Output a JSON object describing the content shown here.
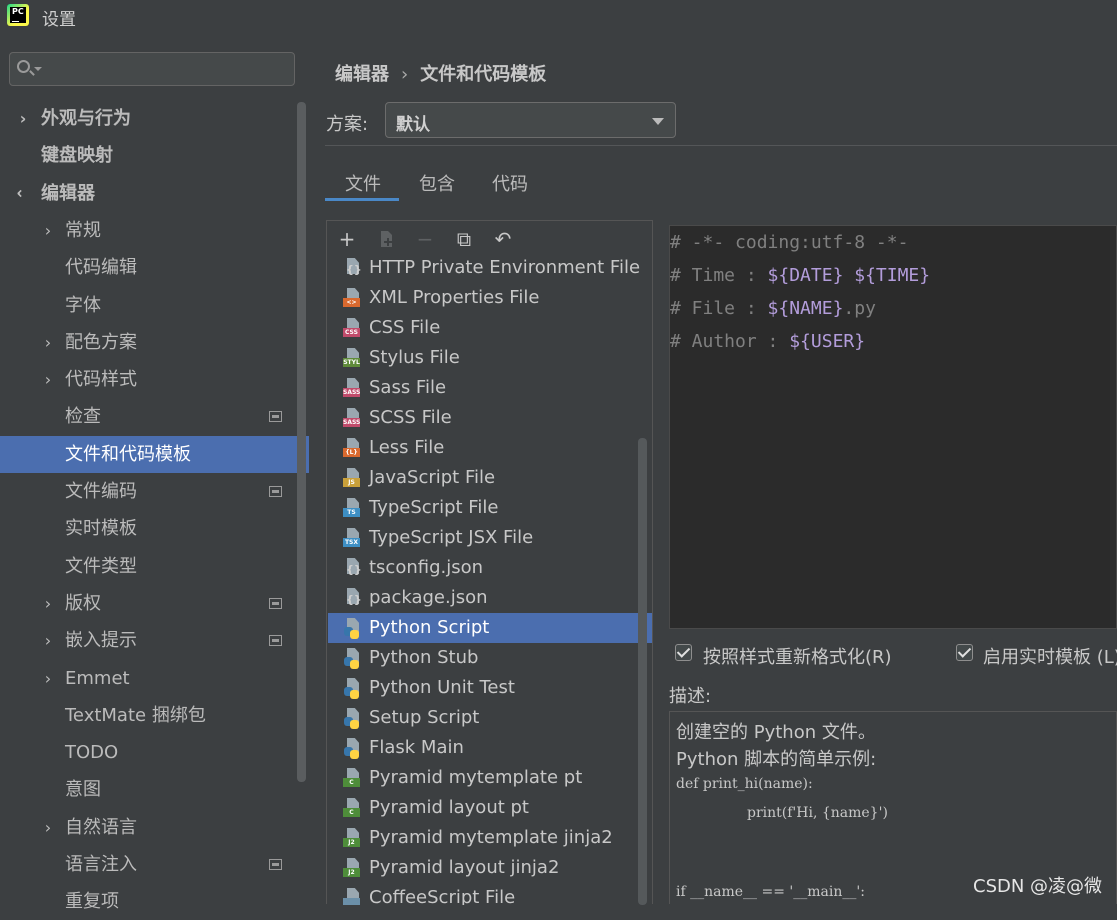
{
  "window": {
    "title": "设置",
    "app_icon_text": "PC"
  },
  "sidebar": {
    "search_placeholder": "",
    "items": [
      {
        "label": "外观与行为",
        "arrow": "›"
      },
      {
        "label": "键盘映射",
        "arrow": ""
      },
      {
        "label": "编辑器",
        "arrow": "⌄"
      },
      {
        "label": "常规",
        "arrow": "›"
      },
      {
        "label": "代码编辑",
        "arrow": ""
      },
      {
        "label": "字体",
        "arrow": ""
      },
      {
        "label": "配色方案",
        "arrow": "›"
      },
      {
        "label": "代码样式",
        "arrow": "›"
      },
      {
        "label": "检查",
        "arrow": ""
      },
      {
        "label": "文件和代码模板",
        "arrow": ""
      },
      {
        "label": "文件编码",
        "arrow": ""
      },
      {
        "label": "实时模板",
        "arrow": ""
      },
      {
        "label": "文件类型",
        "arrow": ""
      },
      {
        "label": "版权",
        "arrow": "›"
      },
      {
        "label": "嵌入提示",
        "arrow": "›"
      },
      {
        "label": "Emmet",
        "arrow": "›"
      },
      {
        "label": "TextMate 捆绑包",
        "arrow": ""
      },
      {
        "label": "TODO",
        "arrow": ""
      },
      {
        "label": "意图",
        "arrow": ""
      },
      {
        "label": "自然语言",
        "arrow": "›"
      },
      {
        "label": "语言注入",
        "arrow": ""
      },
      {
        "label": "重复项",
        "arrow": ""
      }
    ],
    "selected": "文件和代码模板"
  },
  "breadcrumb": {
    "parent": "编辑器",
    "separator": "›",
    "current": "文件和代码模板"
  },
  "scheme": {
    "label": "方案:",
    "value": "默认"
  },
  "tabs": [
    {
      "label": "文件"
    },
    {
      "label": "包含"
    },
    {
      "label": "代码"
    }
  ],
  "active_tab": "文件",
  "toolbar": {
    "add": "+",
    "remove": "−",
    "copy": "⧉",
    "reset": "↶"
  },
  "templates": [
    {
      "label": "HTTP Private Environment File",
      "icon": "json-file-icon",
      "badge": "",
      "color": ""
    },
    {
      "label": "XML Properties File",
      "icon": "xml-file-icon",
      "badge": "<>",
      "color": "#d9692f"
    },
    {
      "label": "CSS File",
      "icon": "css-file-icon",
      "badge": "CSS",
      "color": "#c14b6b"
    },
    {
      "label": "Stylus File",
      "icon": "stylus-file-icon",
      "badge": "STYL",
      "color": "#5f8b3a"
    },
    {
      "label": "Sass File",
      "icon": "sass-file-icon",
      "badge": "SASS",
      "color": "#c14b6b"
    },
    {
      "label": "SCSS File",
      "icon": "scss-file-icon",
      "badge": "SASS",
      "color": "#c14b6b"
    },
    {
      "label": "Less File",
      "icon": "less-file-icon",
      "badge": "{L}",
      "color": "#d9692f"
    },
    {
      "label": "JavaScript File",
      "icon": "javascript-file-icon",
      "badge": "JS",
      "color": "#c9a03a"
    },
    {
      "label": "TypeScript File",
      "icon": "typescript-file-icon",
      "badge": "TS",
      "color": "#3e8fc4"
    },
    {
      "label": "TypeScript JSX File",
      "icon": "tsx-file-icon",
      "badge": "TSX",
      "color": "#3e8fc4"
    },
    {
      "label": "tsconfig.json",
      "icon": "json-file-icon",
      "badge": "",
      "color": ""
    },
    {
      "label": "package.json",
      "icon": "json-file-icon",
      "badge": "",
      "color": ""
    },
    {
      "label": "Python Script",
      "icon": "python-file-icon",
      "badge": "",
      "color": ""
    },
    {
      "label": "Python Stub",
      "icon": "python-file-icon",
      "badge": "",
      "color": ""
    },
    {
      "label": "Python Unit Test",
      "icon": "python-file-icon",
      "badge": "",
      "color": ""
    },
    {
      "label": "Setup Script",
      "icon": "python-file-icon",
      "badge": "",
      "color": ""
    },
    {
      "label": "Flask Main",
      "icon": "python-file-icon",
      "badge": "",
      "color": ""
    },
    {
      "label": "Pyramid mytemplate pt",
      "icon": "chameleon-file-icon",
      "badge": "C",
      "color": "#4e8d3a"
    },
    {
      "label": "Pyramid layout pt",
      "icon": "chameleon-file-icon",
      "badge": "C",
      "color": "#4e8d3a"
    },
    {
      "label": "Pyramid mytemplate jinja2",
      "icon": "jinja2-file-icon",
      "badge": "J2",
      "color": "#4e8d3a"
    },
    {
      "label": "Pyramid layout jinja2",
      "icon": "jinja2-file-icon",
      "badge": "J2",
      "color": "#4e8d3a"
    },
    {
      "label": "CoffeeScript File",
      "icon": "coffeescript-file-icon",
      "badge": "",
      "color": "#6b8fa8"
    }
  ],
  "selected_template": "Python Script",
  "editor": {
    "lines": [
      {
        "prefix": "# -*- coding:utf-8 -*-",
        "var1": "",
        "mid": "",
        "var2": "",
        "suffix": ""
      },
      {
        "prefix": "# Time : ",
        "var1": "${DATE}",
        "mid": " ",
        "var2": "${TIME}",
        "suffix": ""
      },
      {
        "prefix": "# File : ",
        "var1": "${NAME}",
        "mid": ".py",
        "var2": "",
        "suffix": ""
      },
      {
        "prefix": "# Author : ",
        "var1": "${USER}",
        "mid": "",
        "var2": "",
        "suffix": ""
      }
    ]
  },
  "options": {
    "reformat_label": "按照样式重新格式化(R)",
    "reformat_checked": true,
    "live_templates_label": "启用实时模板 (L)",
    "live_templates_checked": true
  },
  "description": {
    "label": "描述:",
    "text_line1": "创建空的 Python 文件。",
    "text_line2": "Python 脚本的简单示例:",
    "code_line1": "def print_hi(name):",
    "code_line2": "print(f'Hi, {name}')",
    "code_line3": "if __name__ == '__main__':"
  },
  "footer_text": "CSDN @凌@微",
  "colors": {
    "selection": "#4b6eaf",
    "background": "#3c3f41",
    "editor_bg": "#2b2b2b",
    "template_var": "#b39ddb",
    "comment": "#808080"
  }
}
